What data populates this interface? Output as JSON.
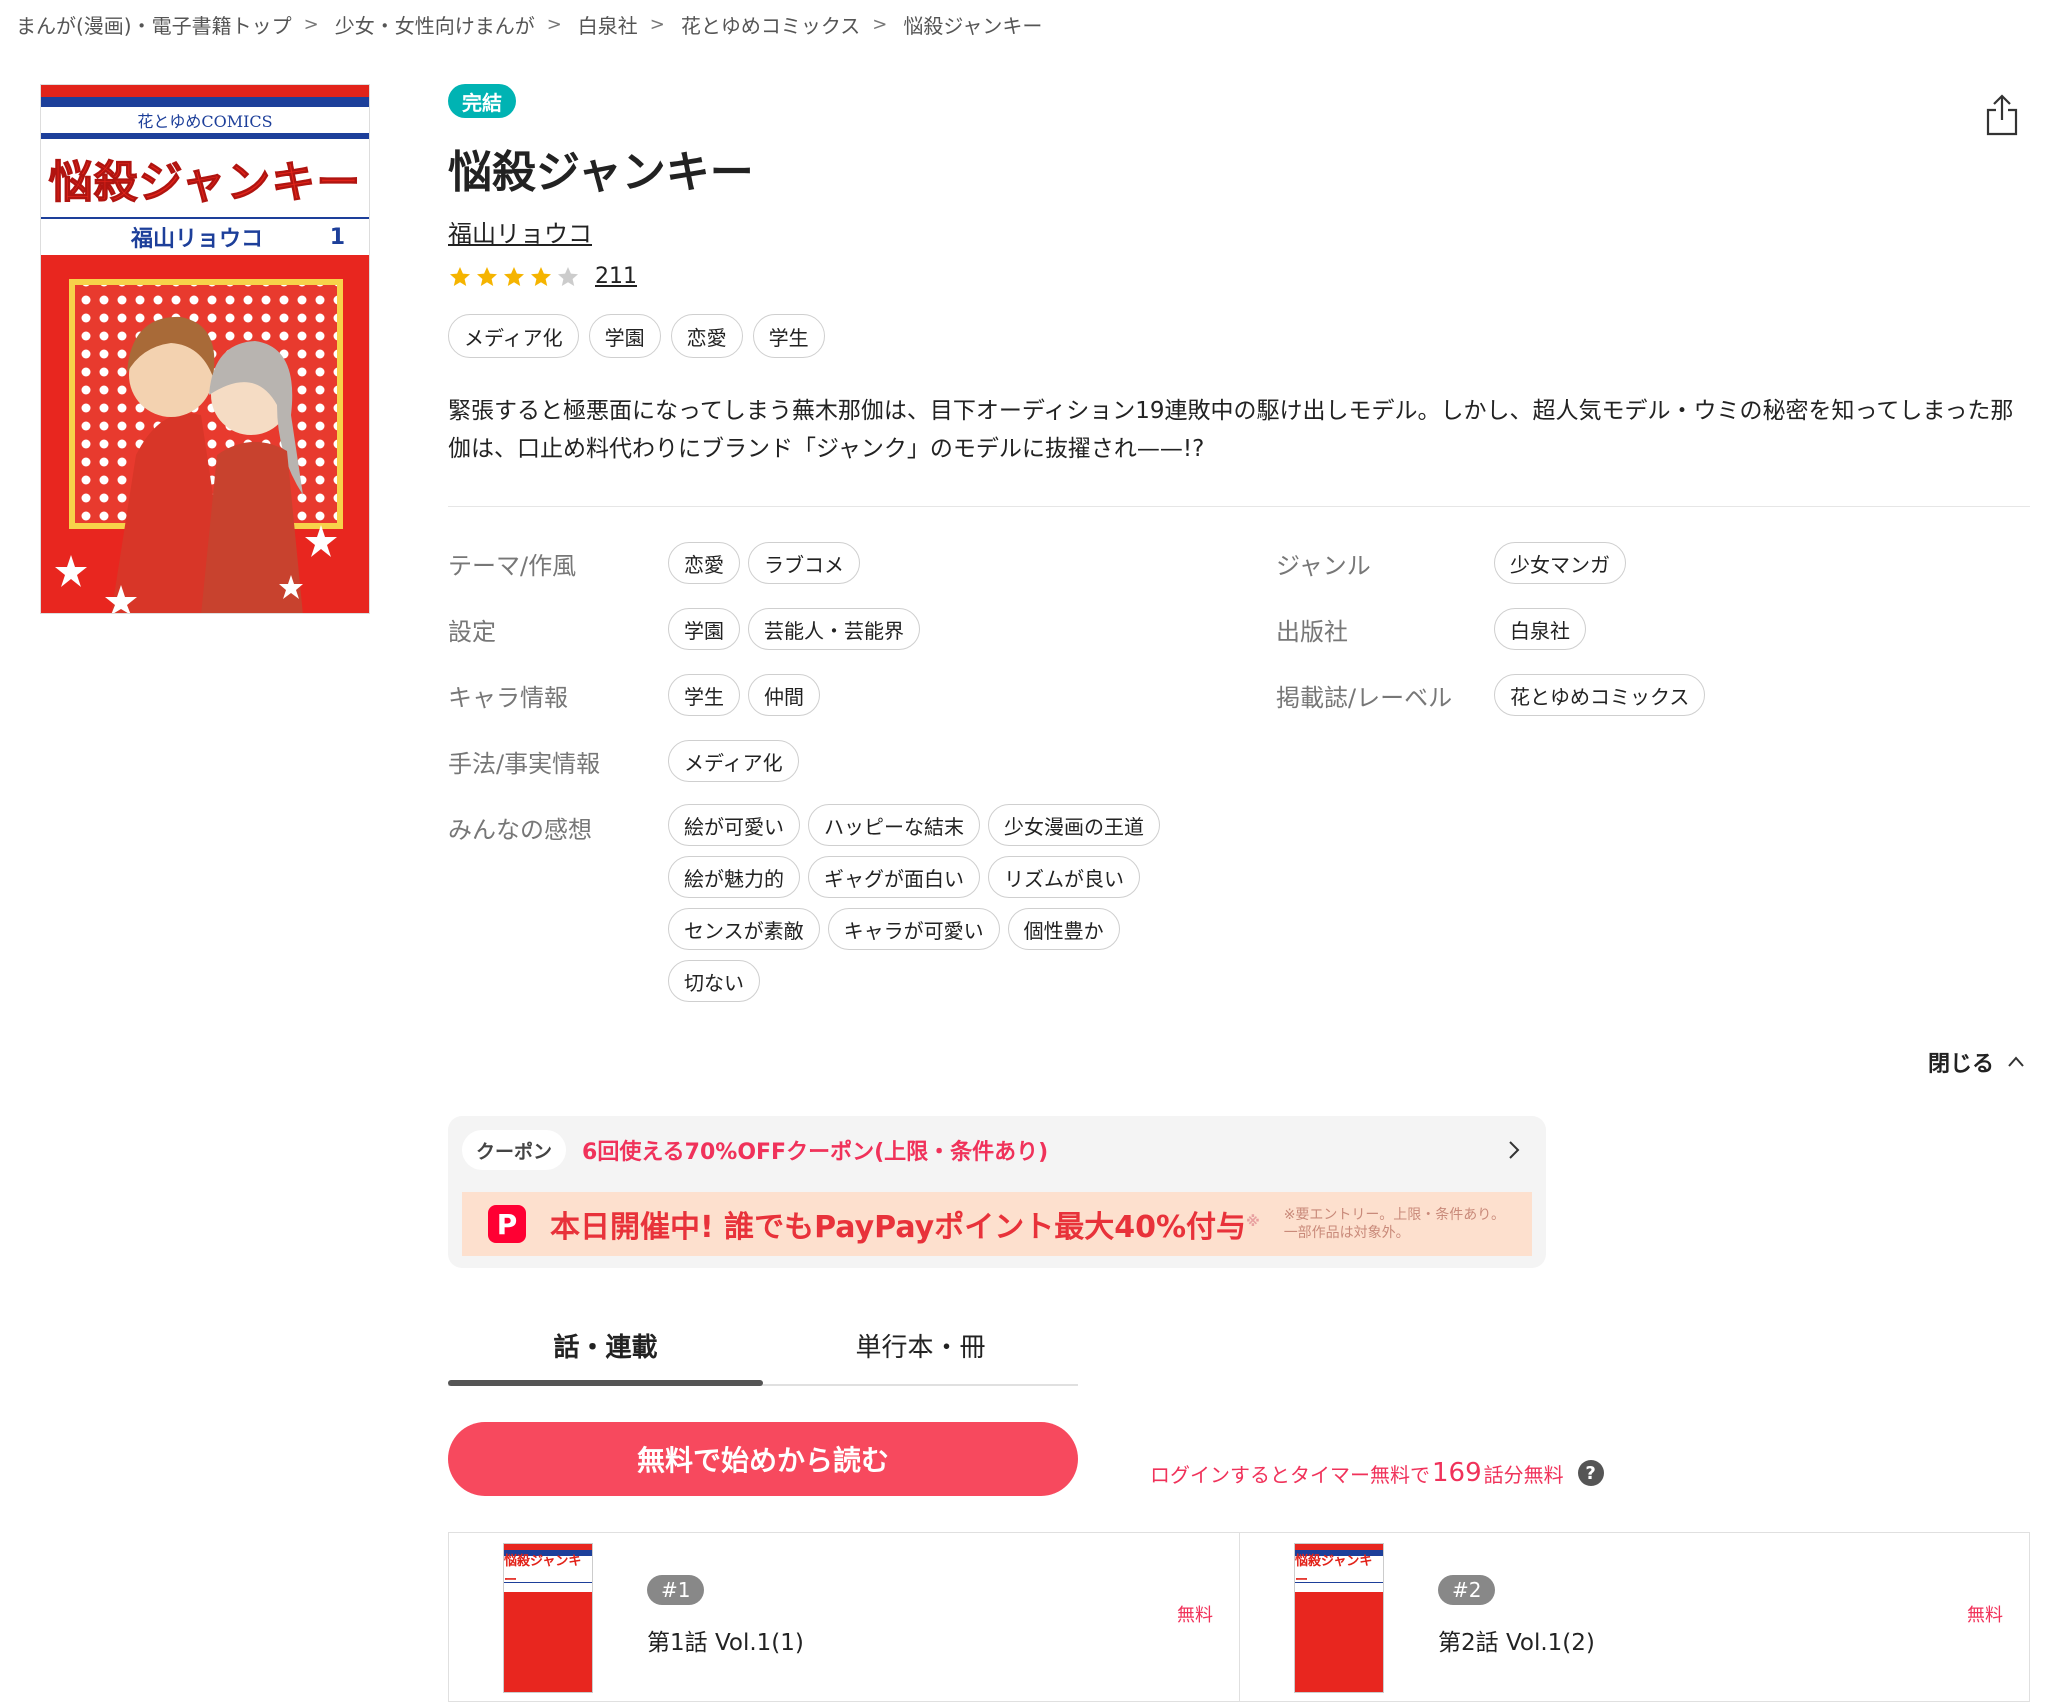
{
  "breadcrumb": [
    "まんが(漫画)・電子書籍トップ",
    "少女・女性向けまんが",
    "白泉社",
    "花とゆめコミックス",
    "悩殺ジャンキー"
  ],
  "breadcrumb_sep": ">",
  "cover": {
    "label": "花とゆめCOMICS",
    "title": "悩殺ジャンキー",
    "author": "福山リョウコ",
    "volume": "1"
  },
  "status_badge": "完結",
  "title": "悩殺ジャンキー",
  "author": "福山リョウコ",
  "rating": {
    "stars": 4,
    "max": 5,
    "count": "211"
  },
  "top_tags": [
    "メディア化",
    "学園",
    "恋愛",
    "学生"
  ],
  "description": "緊張すると極悪面になってしまう蕪木那伽は、目下オーディション19連敗中の駆け出しモデル。しかし、超人気モデル・ウミの秘密を知ってしまった那伽は、口止め料代わりにブランド「ジャンク」のモデルに抜擢され——!?",
  "attributes_left": [
    {
      "label": "テーマ/作風",
      "chips": [
        "恋愛",
        "ラブコメ"
      ]
    },
    {
      "label": "設定",
      "chips": [
        "学園",
        "芸能人・芸能界"
      ]
    },
    {
      "label": "キャラ情報",
      "chips": [
        "学生",
        "仲間"
      ]
    },
    {
      "label": "手法/事実情報",
      "chips": [
        "メディア化"
      ]
    },
    {
      "label": "みんなの感想",
      "chips": [
        "絵が可愛い",
        "ハッピーな結末",
        "少女漫画の王道",
        "絵が魅力的",
        "ギャグが面白い",
        "リズムが良い",
        "センスが素敵",
        "キャラが可愛い",
        "個性豊か",
        "切ない"
      ]
    }
  ],
  "attributes_right": [
    {
      "label": "ジャンル",
      "chips": [
        "少女マンガ"
      ]
    },
    {
      "label": "出版社",
      "chips": [
        "白泉社"
      ]
    },
    {
      "label": "掲載誌/レーベル",
      "chips": [
        "花とゆめコミックス"
      ]
    }
  ],
  "close_label": "閉じる",
  "coupon": {
    "tag": "クーポン",
    "text": "6回使える70%OFFクーポン(上限・条件あり)"
  },
  "paypay_banner": {
    "logo": "P",
    "main": "本日開催中! 誰でもPayPayポイント最大40%付与",
    "mark": "※",
    "note_line1": "※要エントリー。上限・条件あり。",
    "note_line2": "一部作品は対象外。"
  },
  "tabs": [
    {
      "label": "話・連載",
      "active": true
    },
    {
      "label": "単行本・冊",
      "active": false
    }
  ],
  "read_button": "無料で始めから読む",
  "login_note": {
    "prefix": "ログインするとタイマー無料で",
    "num": "169",
    "suffix": "話分無料",
    "help": "?"
  },
  "episodes": [
    {
      "num": "#1",
      "title": "第1話 Vol.1(1)",
      "price": "無料",
      "thumb_title": "悩殺ジャンキー"
    },
    {
      "num": "#2",
      "title": "第2話 Vol.1(2)",
      "price": "無料",
      "thumb_title": "悩殺ジャンキー"
    }
  ],
  "colors": {
    "accent": "#f7495e",
    "complete_badge": "#00b3b3",
    "star": "#f5b400",
    "star_empty": "#cccccc",
    "coupon_text": "#f0325a",
    "paypay_bg": "#fde0ce"
  },
  "icons": {
    "share": "share-icon",
    "star": "star-icon",
    "chevron_up": "chevron-up-icon",
    "chevron_right": "chevron-right-icon",
    "help": "help-icon",
    "paypay": "paypay-logo-icon"
  }
}
